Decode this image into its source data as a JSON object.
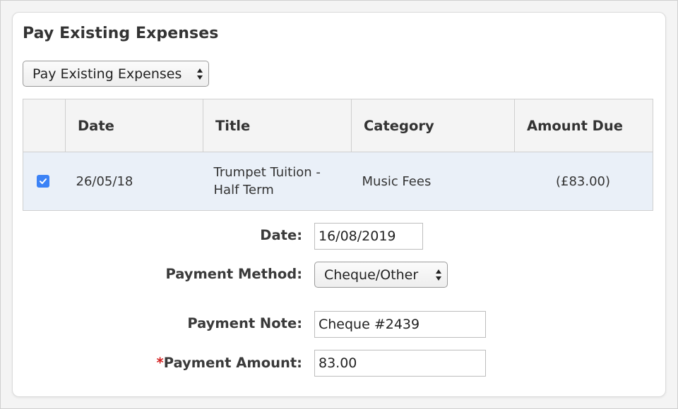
{
  "panel": {
    "title": "Pay Existing Expenses"
  },
  "expense_type_select": {
    "selected": "Pay Existing Expenses"
  },
  "expenses_table": {
    "headers": [
      "",
      "Date",
      "Title",
      "Category",
      "Amount Due"
    ],
    "rows": [
      {
        "checked": true,
        "date": "26/05/18",
        "title": "Trumpet Tuition - Half Term",
        "category": "Music Fees",
        "amount_due": "(£83.00)"
      }
    ]
  },
  "form": {
    "date_label": "Date:",
    "date_value": "16/08/2019",
    "payment_method_label": "Payment Method:",
    "payment_method_selected": "Cheque/Other",
    "payment_note_label": "Payment Note:",
    "payment_note_value": "Cheque #2439",
    "payment_amount_required_marker": "*",
    "payment_amount_label": "Payment Amount:",
    "payment_amount_value": "83.00"
  },
  "colors": {
    "checkbox_accent": "#3b82f6",
    "selected_row_bg": "#eaf0f8",
    "required_marker": "#d42020"
  }
}
